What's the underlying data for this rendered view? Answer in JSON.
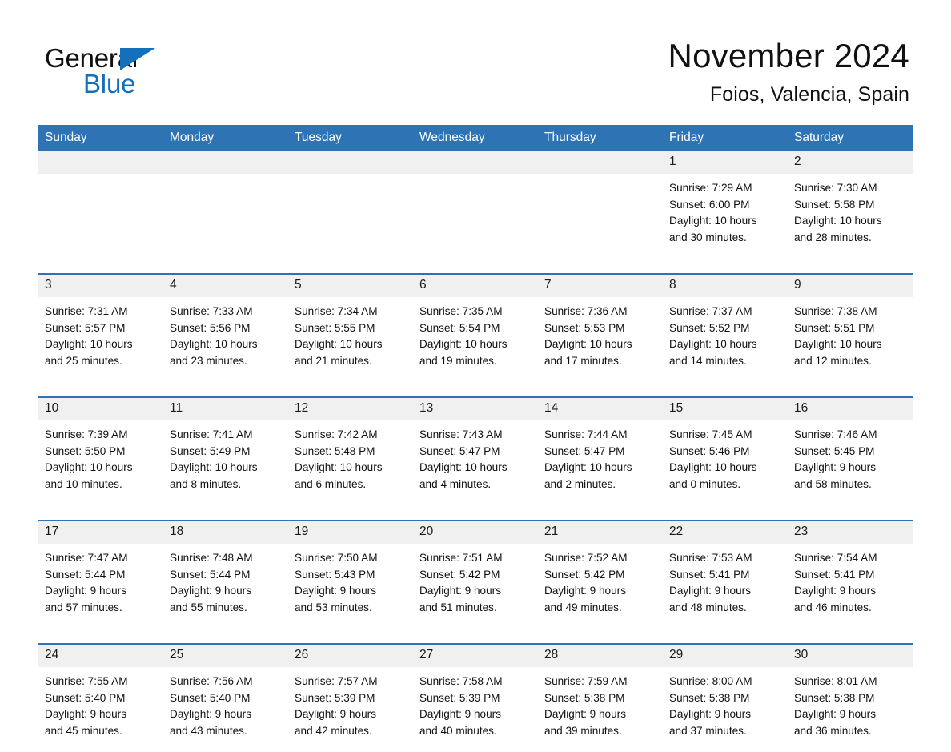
{
  "brand": {
    "name_part1": "General",
    "name_part2": "Blue",
    "flag_icon": "brand-triangle-icon"
  },
  "header": {
    "month_title": "November 2024",
    "location": "Foios, Valencia, Spain"
  },
  "colors": {
    "header_blue": "#2e74b5",
    "brand_blue": "#1470bb",
    "daynum_band": "#f0f0f0",
    "text": "#111111"
  },
  "weekday_headers": [
    "Sunday",
    "Monday",
    "Tuesday",
    "Wednesday",
    "Thursday",
    "Friday",
    "Saturday"
  ],
  "weeks": [
    [
      {
        "day": "",
        "sunrise": "",
        "sunset": "",
        "daylight_line1": "",
        "daylight_line2": ""
      },
      {
        "day": "",
        "sunrise": "",
        "sunset": "",
        "daylight_line1": "",
        "daylight_line2": ""
      },
      {
        "day": "",
        "sunrise": "",
        "sunset": "",
        "daylight_line1": "",
        "daylight_line2": ""
      },
      {
        "day": "",
        "sunrise": "",
        "sunset": "",
        "daylight_line1": "",
        "daylight_line2": ""
      },
      {
        "day": "",
        "sunrise": "",
        "sunset": "",
        "daylight_line1": "",
        "daylight_line2": ""
      },
      {
        "day": "1",
        "sunrise": "Sunrise: 7:29 AM",
        "sunset": "Sunset: 6:00 PM",
        "daylight_line1": "Daylight: 10 hours",
        "daylight_line2": "and 30 minutes."
      },
      {
        "day": "2",
        "sunrise": "Sunrise: 7:30 AM",
        "sunset": "Sunset: 5:58 PM",
        "daylight_line1": "Daylight: 10 hours",
        "daylight_line2": "and 28 minutes."
      }
    ],
    [
      {
        "day": "3",
        "sunrise": "Sunrise: 7:31 AM",
        "sunset": "Sunset: 5:57 PM",
        "daylight_line1": "Daylight: 10 hours",
        "daylight_line2": "and 25 minutes."
      },
      {
        "day": "4",
        "sunrise": "Sunrise: 7:33 AM",
        "sunset": "Sunset: 5:56 PM",
        "daylight_line1": "Daylight: 10 hours",
        "daylight_line2": "and 23 minutes."
      },
      {
        "day": "5",
        "sunrise": "Sunrise: 7:34 AM",
        "sunset": "Sunset: 5:55 PM",
        "daylight_line1": "Daylight: 10 hours",
        "daylight_line2": "and 21 minutes."
      },
      {
        "day": "6",
        "sunrise": "Sunrise: 7:35 AM",
        "sunset": "Sunset: 5:54 PM",
        "daylight_line1": "Daylight: 10 hours",
        "daylight_line2": "and 19 minutes."
      },
      {
        "day": "7",
        "sunrise": "Sunrise: 7:36 AM",
        "sunset": "Sunset: 5:53 PM",
        "daylight_line1": "Daylight: 10 hours",
        "daylight_line2": "and 17 minutes."
      },
      {
        "day": "8",
        "sunrise": "Sunrise: 7:37 AM",
        "sunset": "Sunset: 5:52 PM",
        "daylight_line1": "Daylight: 10 hours",
        "daylight_line2": "and 14 minutes."
      },
      {
        "day": "9",
        "sunrise": "Sunrise: 7:38 AM",
        "sunset": "Sunset: 5:51 PM",
        "daylight_line1": "Daylight: 10 hours",
        "daylight_line2": "and 12 minutes."
      }
    ],
    [
      {
        "day": "10",
        "sunrise": "Sunrise: 7:39 AM",
        "sunset": "Sunset: 5:50 PM",
        "daylight_line1": "Daylight: 10 hours",
        "daylight_line2": "and 10 minutes."
      },
      {
        "day": "11",
        "sunrise": "Sunrise: 7:41 AM",
        "sunset": "Sunset: 5:49 PM",
        "daylight_line1": "Daylight: 10 hours",
        "daylight_line2": "and 8 minutes."
      },
      {
        "day": "12",
        "sunrise": "Sunrise: 7:42 AM",
        "sunset": "Sunset: 5:48 PM",
        "daylight_line1": "Daylight: 10 hours",
        "daylight_line2": "and 6 minutes."
      },
      {
        "day": "13",
        "sunrise": "Sunrise: 7:43 AM",
        "sunset": "Sunset: 5:47 PM",
        "daylight_line1": "Daylight: 10 hours",
        "daylight_line2": "and 4 minutes."
      },
      {
        "day": "14",
        "sunrise": "Sunrise: 7:44 AM",
        "sunset": "Sunset: 5:47 PM",
        "daylight_line1": "Daylight: 10 hours",
        "daylight_line2": "and 2 minutes."
      },
      {
        "day": "15",
        "sunrise": "Sunrise: 7:45 AM",
        "sunset": "Sunset: 5:46 PM",
        "daylight_line1": "Daylight: 10 hours",
        "daylight_line2": "and 0 minutes."
      },
      {
        "day": "16",
        "sunrise": "Sunrise: 7:46 AM",
        "sunset": "Sunset: 5:45 PM",
        "daylight_line1": "Daylight: 9 hours",
        "daylight_line2": "and 58 minutes."
      }
    ],
    [
      {
        "day": "17",
        "sunrise": "Sunrise: 7:47 AM",
        "sunset": "Sunset: 5:44 PM",
        "daylight_line1": "Daylight: 9 hours",
        "daylight_line2": "and 57 minutes."
      },
      {
        "day": "18",
        "sunrise": "Sunrise: 7:48 AM",
        "sunset": "Sunset: 5:44 PM",
        "daylight_line1": "Daylight: 9 hours",
        "daylight_line2": "and 55 minutes."
      },
      {
        "day": "19",
        "sunrise": "Sunrise: 7:50 AM",
        "sunset": "Sunset: 5:43 PM",
        "daylight_line1": "Daylight: 9 hours",
        "daylight_line2": "and 53 minutes."
      },
      {
        "day": "20",
        "sunrise": "Sunrise: 7:51 AM",
        "sunset": "Sunset: 5:42 PM",
        "daylight_line1": "Daylight: 9 hours",
        "daylight_line2": "and 51 minutes."
      },
      {
        "day": "21",
        "sunrise": "Sunrise: 7:52 AM",
        "sunset": "Sunset: 5:42 PM",
        "daylight_line1": "Daylight: 9 hours",
        "daylight_line2": "and 49 minutes."
      },
      {
        "day": "22",
        "sunrise": "Sunrise: 7:53 AM",
        "sunset": "Sunset: 5:41 PM",
        "daylight_line1": "Daylight: 9 hours",
        "daylight_line2": "and 48 minutes."
      },
      {
        "day": "23",
        "sunrise": "Sunrise: 7:54 AM",
        "sunset": "Sunset: 5:41 PM",
        "daylight_line1": "Daylight: 9 hours",
        "daylight_line2": "and 46 minutes."
      }
    ],
    [
      {
        "day": "24",
        "sunrise": "Sunrise: 7:55 AM",
        "sunset": "Sunset: 5:40 PM",
        "daylight_line1": "Daylight: 9 hours",
        "daylight_line2": "and 45 minutes."
      },
      {
        "day": "25",
        "sunrise": "Sunrise: 7:56 AM",
        "sunset": "Sunset: 5:40 PM",
        "daylight_line1": "Daylight: 9 hours",
        "daylight_line2": "and 43 minutes."
      },
      {
        "day": "26",
        "sunrise": "Sunrise: 7:57 AM",
        "sunset": "Sunset: 5:39 PM",
        "daylight_line1": "Daylight: 9 hours",
        "daylight_line2": "and 42 minutes."
      },
      {
        "day": "27",
        "sunrise": "Sunrise: 7:58 AM",
        "sunset": "Sunset: 5:39 PM",
        "daylight_line1": "Daylight: 9 hours",
        "daylight_line2": "and 40 minutes."
      },
      {
        "day": "28",
        "sunrise": "Sunrise: 7:59 AM",
        "sunset": "Sunset: 5:38 PM",
        "daylight_line1": "Daylight: 9 hours",
        "daylight_line2": "and 39 minutes."
      },
      {
        "day": "29",
        "sunrise": "Sunrise: 8:00 AM",
        "sunset": "Sunset: 5:38 PM",
        "daylight_line1": "Daylight: 9 hours",
        "daylight_line2": "and 37 minutes."
      },
      {
        "day": "30",
        "sunrise": "Sunrise: 8:01 AM",
        "sunset": "Sunset: 5:38 PM",
        "daylight_line1": "Daylight: 9 hours",
        "daylight_line2": "and 36 minutes."
      }
    ]
  ]
}
